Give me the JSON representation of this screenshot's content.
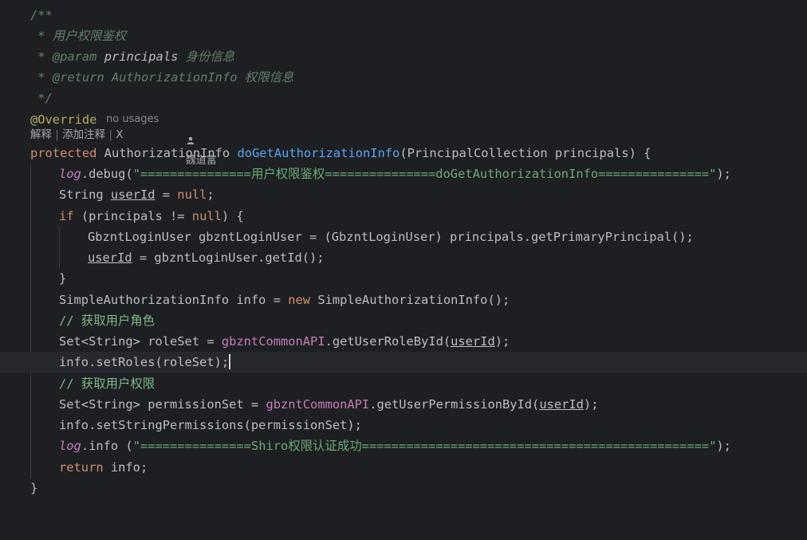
{
  "doc": {
    "open": "/**",
    "desc": " * 用户权限鉴权",
    "param_star": " * ",
    "param_tag": "@param",
    "param_name": " principals",
    "param_desc": " 身份信息",
    "return_star": " * ",
    "return_tag": "@return",
    "return_type": " AuthorizationInfo",
    "return_desc": " 权限信息",
    "close": " */"
  },
  "annotation": "@Override",
  "hints": {
    "usages": "no usages",
    "author": "魏道富",
    "explain": "解释",
    "sep1": " | ",
    "add_comment": "添加注释",
    "sep2": " | ",
    "close": "X"
  },
  "code": {
    "sig_kw": "protected",
    "sig_type": " AuthorizationInfo ",
    "sig_fn": "doGetAuthorizationInfo",
    "sig_rest": "(PrincipalCollection principals) {",
    "l1_log": "log",
    "l1_mid": ".debug(",
    "l1_str": "\"===============用户权限鉴权===============doGetAuthorizationInfo===============\"",
    "l1_end": ");",
    "l2_a": "String ",
    "l2_var": "userId",
    "l2_b": " = ",
    "l2_null": "null",
    "l2_c": ";",
    "l3_kw": "if",
    "l3_a": " (principals != ",
    "l3_null": "null",
    "l3_b": ") {",
    "l4": "GbzntLoginUser gbzntLoginUser = (GbzntLoginUser) principals.getPrimaryPrincipal();",
    "l5_var": "userId",
    "l5_rest": " = gbzntLoginUser.getId();",
    "l6": "}",
    "l7_a": "SimpleAuthorizationInfo info = ",
    "l7_kw": "new",
    "l7_b": " SimpleAuthorizationInfo();",
    "l8": "// 获取用户角色",
    "l9_a": "Set<String> roleSet = ",
    "l9_api": "gbzntCommonAPI",
    "l9_b": ".getUserRoleById(",
    "l9_var": "userId",
    "l9_c": ");",
    "l10": "info.setRoles(roleSet);",
    "l11": "// 获取用户权限",
    "l12_a": "Set<String> permissionSet = ",
    "l12_api": "gbzntCommonAPI",
    "l12_b": ".getUserPermissionById(",
    "l12_var": "userId",
    "l12_c": ");",
    "l13": "info.setStringPermissions(permissionSet);",
    "l14_log": "log",
    "l14_mid": ".info (",
    "l14_str": "\"===============Shiro权限认证成功===============================================\"",
    "l14_end": ");",
    "l15_kw": "return",
    "l15_rest": " info;",
    "l16": "}"
  },
  "colors": {
    "background": "#1e1f22",
    "current_line": "#26282e",
    "keyword": "#cf8e6d",
    "function": "#56a8f5",
    "string": "#6aab73",
    "field": "#c77dbb",
    "annotation": "#b3ae60",
    "comment": "#5f826b"
  }
}
